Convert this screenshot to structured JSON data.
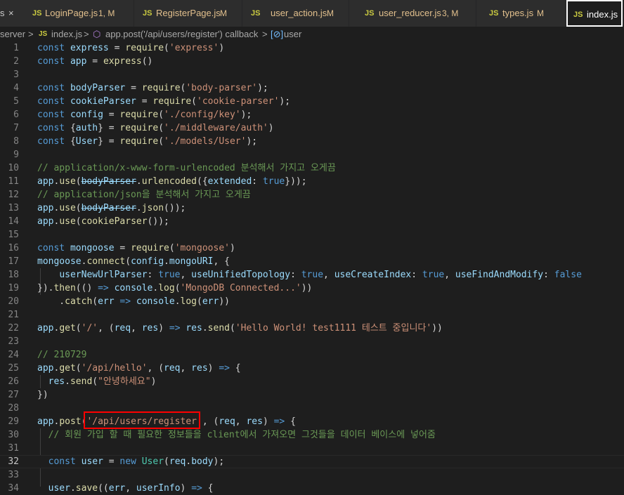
{
  "tabs": [
    {
      "prefix": "",
      "name": "s",
      "status": "",
      "modified": false,
      "active": false,
      "close": "×"
    },
    {
      "prefix": "JS",
      "name": "LoginPage.js",
      "status": "1, M",
      "modified": true,
      "active": false
    },
    {
      "prefix": "JS",
      "name": "RegisterPage.js",
      "status": "M",
      "modified": true,
      "active": false
    },
    {
      "prefix": "JS",
      "name": "user_action.js",
      "status": "M",
      "modified": true,
      "active": false
    },
    {
      "prefix": "JS",
      "name": "user_reducer.js",
      "status": "3, M",
      "modified": true,
      "active": false
    },
    {
      "prefix": "JS",
      "name": "types.js",
      "status": "M",
      "modified": true,
      "active": false
    },
    {
      "prefix": "JS",
      "name": "index.js",
      "status": "",
      "modified": false,
      "active": true
    }
  ],
  "breadcrumb": {
    "folder": "server",
    "file_prefix": "JS",
    "file": "index.js",
    "callback": "app.post('/api/users/register') callback",
    "variable": "user",
    "separator": ">"
  },
  "highlight": {
    "text": "'/api/users/register'",
    "color": "#ff0000"
  },
  "colors": {
    "keyword": "#569cd6",
    "variable": "#9cdcfe",
    "function": "#dcdcaa",
    "string": "#ce9178",
    "comment": "#6a9955",
    "class": "#4ec9b0"
  },
  "lines": [
    {
      "n": "1",
      "tokens": [
        [
          "kw",
          "const"
        ],
        [
          "pn",
          " "
        ],
        [
          "var",
          "express"
        ],
        [
          "pn",
          " = "
        ],
        [
          "fn",
          "require"
        ],
        [
          "pn",
          "("
        ],
        [
          "str",
          "'express'"
        ],
        [
          "pn",
          ")"
        ]
      ]
    },
    {
      "n": "2",
      "tokens": [
        [
          "kw",
          "const"
        ],
        [
          "pn",
          " "
        ],
        [
          "var",
          "app"
        ],
        [
          "pn",
          " = "
        ],
        [
          "fn",
          "express"
        ],
        [
          "pn",
          "()"
        ]
      ]
    },
    {
      "n": "3",
      "tokens": []
    },
    {
      "n": "4",
      "tokens": [
        [
          "kw",
          "const"
        ],
        [
          "pn",
          " "
        ],
        [
          "var",
          "bodyParser"
        ],
        [
          "pn",
          " = "
        ],
        [
          "fn",
          "require"
        ],
        [
          "pn",
          "("
        ],
        [
          "str",
          "'body-parser'"
        ],
        [
          "pn",
          ");"
        ]
      ]
    },
    {
      "n": "5",
      "tokens": [
        [
          "kw",
          "const"
        ],
        [
          "pn",
          " "
        ],
        [
          "var",
          "cookieParser"
        ],
        [
          "pn",
          " = "
        ],
        [
          "fn",
          "require"
        ],
        [
          "pn",
          "("
        ],
        [
          "str",
          "'cookie-parser'"
        ],
        [
          "pn",
          ");"
        ]
      ]
    },
    {
      "n": "6",
      "tokens": [
        [
          "kw",
          "const"
        ],
        [
          "pn",
          " "
        ],
        [
          "var",
          "config"
        ],
        [
          "pn",
          " = "
        ],
        [
          "fn",
          "require"
        ],
        [
          "pn",
          "("
        ],
        [
          "str",
          "'./config/key'"
        ],
        [
          "pn",
          ");"
        ]
      ]
    },
    {
      "n": "7",
      "tokens": [
        [
          "kw",
          "const"
        ],
        [
          "pn",
          " {"
        ],
        [
          "var",
          "auth"
        ],
        [
          "pn",
          "} = "
        ],
        [
          "fn",
          "require"
        ],
        [
          "pn",
          "("
        ],
        [
          "str",
          "'./middleware/auth'"
        ],
        [
          "pn",
          ")"
        ]
      ]
    },
    {
      "n": "8",
      "tokens": [
        [
          "kw",
          "const"
        ],
        [
          "pn",
          " {"
        ],
        [
          "var",
          "User"
        ],
        [
          "pn",
          "} = "
        ],
        [
          "fn",
          "require"
        ],
        [
          "pn",
          "("
        ],
        [
          "str",
          "'./models/User'"
        ],
        [
          "pn",
          ");"
        ]
      ]
    },
    {
      "n": "9",
      "tokens": []
    },
    {
      "n": "10",
      "tokens": [
        [
          "cm",
          "// application/x-www-form-urlencoded 분석해서 가지고 오게끔"
        ]
      ]
    },
    {
      "n": "11",
      "tokens": [
        [
          "var",
          "app"
        ],
        [
          "pn",
          "."
        ],
        [
          "fn",
          "use"
        ],
        [
          "pn",
          "("
        ],
        [
          "dep",
          "bodyParser"
        ],
        [
          "pn",
          "."
        ],
        [
          "fn",
          "urlencoded"
        ],
        [
          "pn",
          "({"
        ],
        [
          "var",
          "extended"
        ],
        [
          "pn",
          ": "
        ],
        [
          "kw",
          "true"
        ],
        [
          "pn",
          "}));"
        ]
      ]
    },
    {
      "n": "12",
      "tokens": [
        [
          "cm",
          "// application/json을 분석해서 가지고 오게끔"
        ]
      ]
    },
    {
      "n": "13",
      "tokens": [
        [
          "var",
          "app"
        ],
        [
          "pn",
          "."
        ],
        [
          "fn",
          "use"
        ],
        [
          "pn",
          "("
        ],
        [
          "dep",
          "bodyParser"
        ],
        [
          "pn",
          "."
        ],
        [
          "fn",
          "json"
        ],
        [
          "pn",
          "());"
        ]
      ]
    },
    {
      "n": "14",
      "tokens": [
        [
          "var",
          "app"
        ],
        [
          "pn",
          "."
        ],
        [
          "fn",
          "use"
        ],
        [
          "pn",
          "("
        ],
        [
          "fn",
          "cookieParser"
        ],
        [
          "pn",
          "());"
        ]
      ]
    },
    {
      "n": "15",
      "tokens": []
    },
    {
      "n": "16",
      "tokens": [
        [
          "kw",
          "const"
        ],
        [
          "pn",
          " "
        ],
        [
          "var",
          "mongoose"
        ],
        [
          "pn",
          " = "
        ],
        [
          "fn",
          "require"
        ],
        [
          "pn",
          "("
        ],
        [
          "str",
          "'mongoose'"
        ],
        [
          "pn",
          ")"
        ]
      ]
    },
    {
      "n": "17",
      "tokens": [
        [
          "var",
          "mongoose"
        ],
        [
          "pn",
          "."
        ],
        [
          "fn",
          "connect"
        ],
        [
          "pn",
          "("
        ],
        [
          "var",
          "config"
        ],
        [
          "pn",
          "."
        ],
        [
          "var",
          "mongoURI"
        ],
        [
          "pn",
          ", {"
        ]
      ]
    },
    {
      "n": "18",
      "tokens": [
        [
          "pn",
          "    "
        ],
        [
          "var",
          "userNewUrlParser"
        ],
        [
          "pn",
          ": "
        ],
        [
          "kw",
          "true"
        ],
        [
          "pn",
          ", "
        ],
        [
          "var",
          "useUnifiedTopology"
        ],
        [
          "pn",
          ": "
        ],
        [
          "kw",
          "true"
        ],
        [
          "pn",
          ", "
        ],
        [
          "var",
          "useCreateIndex"
        ],
        [
          "pn",
          ": "
        ],
        [
          "kw",
          "true"
        ],
        [
          "pn",
          ", "
        ],
        [
          "var",
          "useFindAndModify"
        ],
        [
          "pn",
          ": "
        ],
        [
          "kw",
          "false"
        ]
      ]
    },
    {
      "n": "19",
      "tokens": [
        [
          "pn",
          "})."
        ],
        [
          "fn",
          "then"
        ],
        [
          "pn",
          "(() "
        ],
        [
          "kw",
          "=>"
        ],
        [
          "pn",
          " "
        ],
        [
          "var",
          "console"
        ],
        [
          "pn",
          "."
        ],
        [
          "fn",
          "log"
        ],
        [
          "pn",
          "("
        ],
        [
          "str",
          "'MongoDB Connected...'"
        ],
        [
          "pn",
          "))"
        ]
      ]
    },
    {
      "n": "20",
      "tokens": [
        [
          "pn",
          "    ."
        ],
        [
          "fn",
          "catch"
        ],
        [
          "pn",
          "("
        ],
        [
          "var",
          "err"
        ],
        [
          "pn",
          " "
        ],
        [
          "kw",
          "=>"
        ],
        [
          "pn",
          " "
        ],
        [
          "var",
          "console"
        ],
        [
          "pn",
          "."
        ],
        [
          "fn",
          "log"
        ],
        [
          "pn",
          "("
        ],
        [
          "var",
          "err"
        ],
        [
          "pn",
          "))"
        ]
      ]
    },
    {
      "n": "21",
      "tokens": []
    },
    {
      "n": "22",
      "tokens": [
        [
          "var",
          "app"
        ],
        [
          "pn",
          "."
        ],
        [
          "fn",
          "get"
        ],
        [
          "pn",
          "("
        ],
        [
          "str",
          "'/'"
        ],
        [
          "pn",
          ", ("
        ],
        [
          "var",
          "req"
        ],
        [
          "pn",
          ", "
        ],
        [
          "var",
          "res"
        ],
        [
          "pn",
          ") "
        ],
        [
          "kw",
          "=>"
        ],
        [
          "pn",
          " "
        ],
        [
          "var",
          "res"
        ],
        [
          "pn",
          "."
        ],
        [
          "fn",
          "send"
        ],
        [
          "pn",
          "("
        ],
        [
          "str",
          "'Hello World! test1111 테스트 중입니다'"
        ],
        [
          "pn",
          "))"
        ]
      ]
    },
    {
      "n": "23",
      "tokens": []
    },
    {
      "n": "24",
      "tokens": [
        [
          "cm",
          "// 210729"
        ]
      ]
    },
    {
      "n": "25",
      "tokens": [
        [
          "var",
          "app"
        ],
        [
          "pn",
          "."
        ],
        [
          "fn",
          "get"
        ],
        [
          "pn",
          "("
        ],
        [
          "str",
          "'/api/hello'"
        ],
        [
          "pn",
          ", ("
        ],
        [
          "var",
          "req"
        ],
        [
          "pn",
          ", "
        ],
        [
          "var",
          "res"
        ],
        [
          "pn",
          ") "
        ],
        [
          "kw",
          "=>"
        ],
        [
          "pn",
          " {"
        ]
      ]
    },
    {
      "n": "26",
      "tokens": [
        [
          "pn",
          "  "
        ],
        [
          "var",
          "res"
        ],
        [
          "pn",
          "."
        ],
        [
          "fn",
          "send"
        ],
        [
          "pn",
          "("
        ],
        [
          "str",
          "\"안녕하세요\""
        ],
        [
          "pn",
          ")"
        ]
      ]
    },
    {
      "n": "27",
      "tokens": [
        [
          "pn",
          "})"
        ]
      ]
    },
    {
      "n": "28",
      "tokens": []
    },
    {
      "n": "29",
      "tokens": [
        [
          "var",
          "app"
        ],
        [
          "pn",
          "."
        ],
        [
          "fn",
          "post"
        ],
        [
          "pn",
          "("
        ],
        [
          "str",
          "'/api/users/register'"
        ],
        [
          "pn",
          ", ("
        ],
        [
          "var",
          "req"
        ],
        [
          "pn",
          ", "
        ],
        [
          "var",
          "res"
        ],
        [
          "pn",
          ") "
        ],
        [
          "kw",
          "=>"
        ],
        [
          "pn",
          " {"
        ]
      ]
    },
    {
      "n": "30",
      "tokens": [
        [
          "pn",
          "  "
        ],
        [
          "cm",
          "// 회원 가입 할 때 필요한 정보들을 client에서 가져오면 그것들을 데이터 베이스에 넣어줌"
        ]
      ]
    },
    {
      "n": "31",
      "tokens": []
    },
    {
      "n": "32",
      "tokens": [
        [
          "pn",
          "  "
        ],
        [
          "kw",
          "const"
        ],
        [
          "pn",
          " "
        ],
        [
          "var",
          "user"
        ],
        [
          "pn",
          " = "
        ],
        [
          "kw",
          "new"
        ],
        [
          "pn",
          " "
        ],
        [
          "cls",
          "User"
        ],
        [
          "pn",
          "("
        ],
        [
          "var",
          "req"
        ],
        [
          "pn",
          "."
        ],
        [
          "var",
          "body"
        ],
        [
          "pn",
          ");"
        ]
      ]
    },
    {
      "n": "33",
      "tokens": []
    },
    {
      "n": "34",
      "tokens": [
        [
          "pn",
          "  "
        ],
        [
          "var",
          "user"
        ],
        [
          "pn",
          "."
        ],
        [
          "fn",
          "save"
        ],
        [
          "pn",
          "(("
        ],
        [
          "var",
          "err"
        ],
        [
          "pn",
          ", "
        ],
        [
          "var",
          "userInfo"
        ],
        [
          "pn",
          ") "
        ],
        [
          "kw",
          "=>"
        ],
        [
          "pn",
          " {"
        ]
      ]
    }
  ],
  "current_line": "32"
}
